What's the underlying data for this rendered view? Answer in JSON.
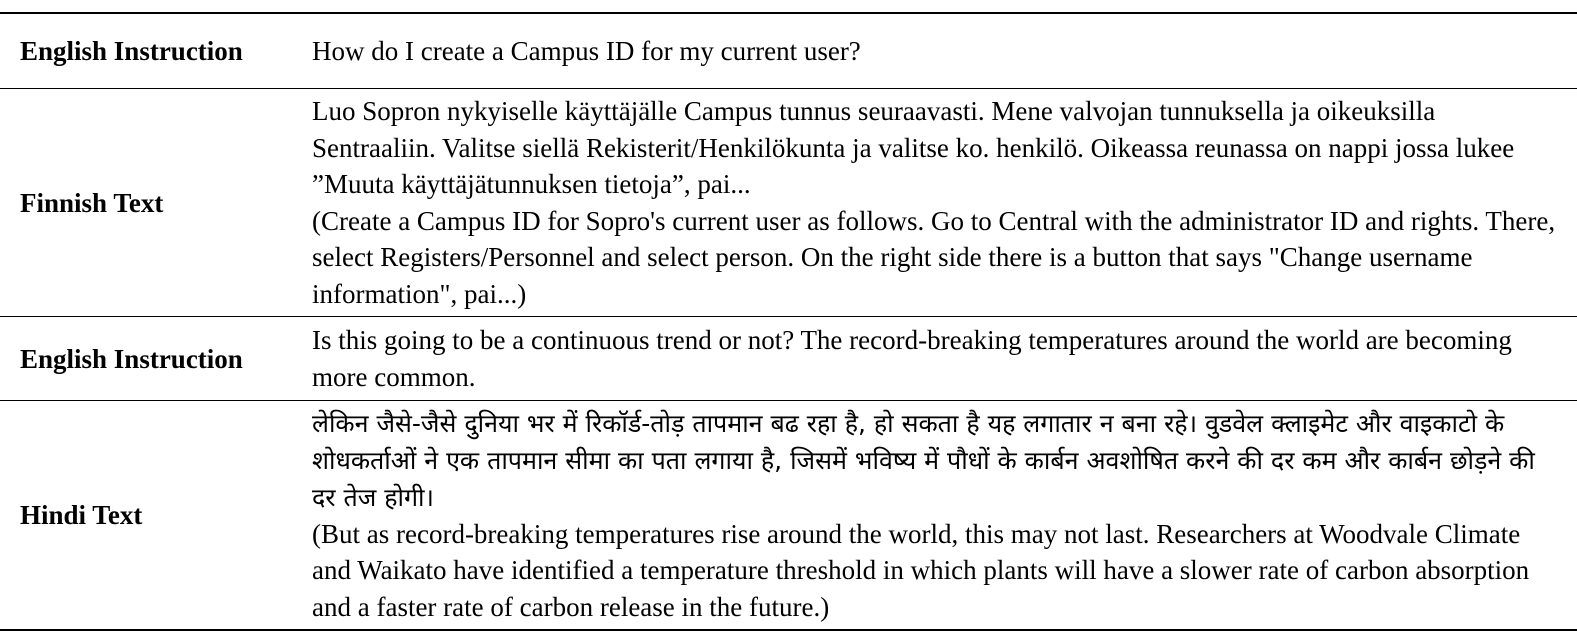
{
  "rows": [
    {
      "label": "English Instruction",
      "paragraphs": [
        "How do I create a Campus ID for my current user?"
      ]
    },
    {
      "label": "Finnish Text",
      "paragraphs": [
        "Luo Sopron nykyiselle käyttäjälle Campus tunnus seuraavasti. Mene valvojan tunnuksella ja oikeuksilla Sentraaliin. Valitse siellä Rekisterit/Henkilökunta ja valitse ko. henkilö. Oikeassa reunassa on nappi jossa lukee ”Muuta käyttäjätunnuksen tietoja”, pai...",
        "(Create a Campus ID for Sopro's current user as follows. Go to Central with the administrator ID and rights. There, select Registers/Personnel and select person. On the right side there is a button that says \"Change username information\", pai...)"
      ]
    },
    {
      "label": "English Instruction",
      "paragraphs": [
        "Is this going to be a continuous trend or not? The record-breaking temperatures around the world are becoming more common."
      ]
    },
    {
      "label": "Hindi Text",
      "paragraphs": [
        "लेकिन जैसे-जैसे दुनिया भर में रिकॉर्ड-तोड़ तापमान बढ रहा है, हो सकता है यह लगातार न बना रहे। वुडवेल क्लाइमेट और वाइकाटो के शोधकर्ताओं ने एक तापमान सीमा का पता लगाया है, जिसमें भविष्य में पौधों के कार्बन अवशोषित करने की दर कम और कार्बन छोड़ने की दर तेज होगी।",
        "(But as record-breaking temperatures rise around the world, this may not last. Researchers at Woodvale Climate and Waikato have identified a temperature threshold in which plants will have a slower rate of carbon absorption and a faster rate of carbon release in the future.)"
      ]
    }
  ]
}
